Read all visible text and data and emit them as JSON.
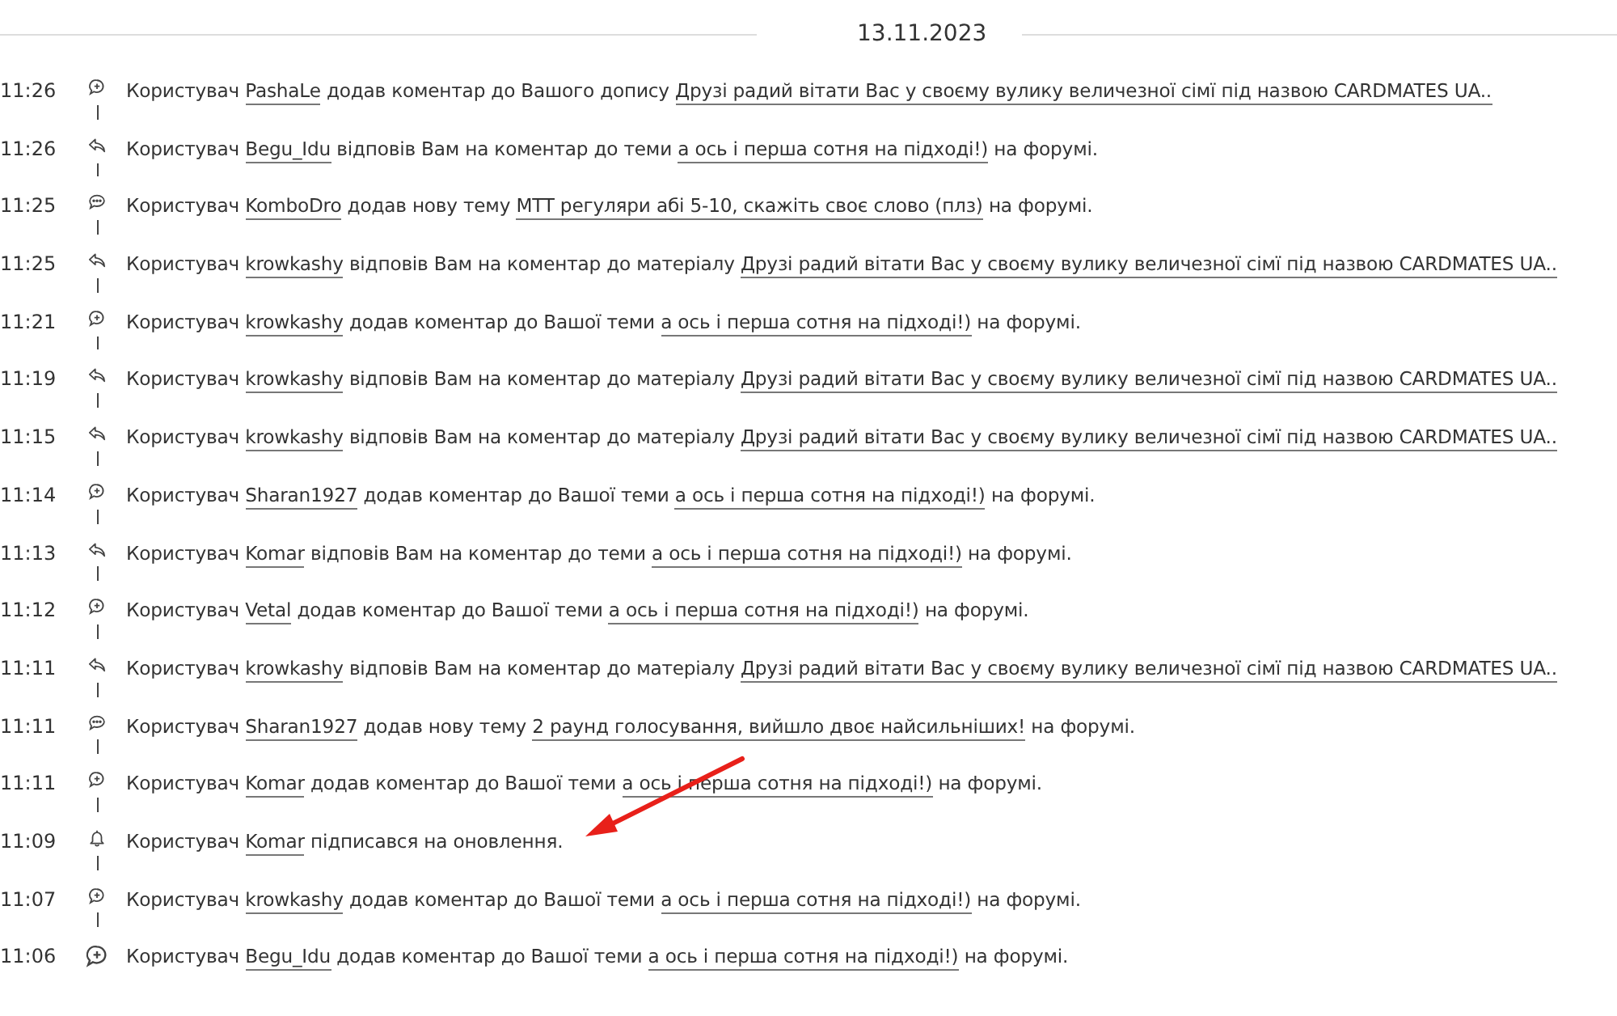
{
  "date": "13.11.2023",
  "notifications": [
    {
      "time": "11:26",
      "kind": "comment",
      "message": [
        {
          "kind": "text",
          "text": "Користувач"
        },
        {
          "kind": "user",
          "text": "PashaLe"
        },
        {
          "kind": "text",
          "text": "додав коментар до Вашого допису"
        },
        {
          "kind": "topic",
          "text": "Друзі радий вітати Вас у своєму вулику величезної сімї під назвою CARDMATES UA.."
        }
      ]
    },
    {
      "time": "11:26",
      "kind": "reply",
      "message": [
        {
          "kind": "text",
          "text": "Користувач"
        },
        {
          "kind": "user",
          "text": "Begu_Idu"
        },
        {
          "kind": "text",
          "text": "відповів Вам на коментар до теми"
        },
        {
          "kind": "topic",
          "text": "а ось і перша сотня на підході!)"
        },
        {
          "kind": "text",
          "text": "на форумі."
        }
      ]
    },
    {
      "time": "11:25",
      "kind": "topic",
      "message": [
        {
          "kind": "text",
          "text": "Користувач"
        },
        {
          "kind": "user",
          "text": "KomboDro"
        },
        {
          "kind": "text",
          "text": "додав нову тему"
        },
        {
          "kind": "topic",
          "text": "MTT регуляри абі 5-10, скажіть своє слово (плз)"
        },
        {
          "kind": "text",
          "text": "на форумі."
        }
      ]
    },
    {
      "time": "11:25",
      "kind": "reply",
      "message": [
        {
          "kind": "text",
          "text": "Користувач"
        },
        {
          "kind": "user",
          "text": "krowkashy"
        },
        {
          "kind": "text",
          "text": "відповів Вам на коментар до матеріалу"
        },
        {
          "kind": "topic",
          "text": "Друзі радий вітати Вас у своєму вулику величезної сімї під назвою CARDMATES UA.."
        }
      ]
    },
    {
      "time": "11:21",
      "kind": "comment",
      "message": [
        {
          "kind": "text",
          "text": "Користувач"
        },
        {
          "kind": "user",
          "text": "krowkashy"
        },
        {
          "kind": "text",
          "text": "додав коментар до Вашої теми"
        },
        {
          "kind": "topic",
          "text": "а ось і перша сотня на підході!)"
        },
        {
          "kind": "text",
          "text": "на форумі."
        }
      ]
    },
    {
      "time": "11:19",
      "kind": "reply",
      "message": [
        {
          "kind": "text",
          "text": "Користувач"
        },
        {
          "kind": "user",
          "text": "krowkashy"
        },
        {
          "kind": "text",
          "text": "відповів Вам на коментар до матеріалу"
        },
        {
          "kind": "topic",
          "text": "Друзі радий вітати Вас у своєму вулику величезної сімї під назвою CARDMATES UA.."
        }
      ]
    },
    {
      "time": "11:15",
      "kind": "reply",
      "message": [
        {
          "kind": "text",
          "text": "Користувач"
        },
        {
          "kind": "user",
          "text": "krowkashy"
        },
        {
          "kind": "text",
          "text": "відповів Вам на коментар до матеріалу"
        },
        {
          "kind": "topic",
          "text": "Друзі радий вітати Вас у своєму вулику величезної сімї під назвою CARDMATES UA.."
        }
      ]
    },
    {
      "time": "11:14",
      "kind": "comment",
      "message": [
        {
          "kind": "text",
          "text": "Користувач"
        },
        {
          "kind": "user",
          "text": "Sharan1927"
        },
        {
          "kind": "text",
          "text": "додав коментар до Вашої теми"
        },
        {
          "kind": "topic",
          "text": "а ось і перша сотня на підході!)"
        },
        {
          "kind": "text",
          "text": "на форумі."
        }
      ]
    },
    {
      "time": "11:13",
      "kind": "reply",
      "message": [
        {
          "kind": "text",
          "text": "Користувач"
        },
        {
          "kind": "user",
          "text": "Komar"
        },
        {
          "kind": "text",
          "text": "відповів Вам на коментар до теми"
        },
        {
          "kind": "topic",
          "text": "а ось і перша сотня на підході!)"
        },
        {
          "kind": "text",
          "text": "на форумі."
        }
      ]
    },
    {
      "time": "11:12",
      "kind": "comment",
      "message": [
        {
          "kind": "text",
          "text": "Користувач"
        },
        {
          "kind": "user",
          "text": "Vetal"
        },
        {
          "kind": "text",
          "text": "додав коментар до Вашої теми"
        },
        {
          "kind": "topic",
          "text": "а ось і перша сотня на підході!)"
        },
        {
          "kind": "text",
          "text": "на форумі."
        }
      ]
    },
    {
      "time": "11:11",
      "kind": "reply",
      "message": [
        {
          "kind": "text",
          "text": "Користувач"
        },
        {
          "kind": "user",
          "text": "krowkashy"
        },
        {
          "kind": "text",
          "text": "відповів Вам на коментар до матеріалу"
        },
        {
          "kind": "topic",
          "text": "Друзі радий вітати Вас у своєму вулику величезної сімї під назвою CARDMATES UA.."
        }
      ]
    },
    {
      "time": "11:11",
      "kind": "topic",
      "message": [
        {
          "kind": "text",
          "text": "Користувач"
        },
        {
          "kind": "user",
          "text": "Sharan1927"
        },
        {
          "kind": "text",
          "text": "додав нову тему"
        },
        {
          "kind": "topic",
          "text": "2 раунд голосування, вийшло двоє найсильніших!"
        },
        {
          "kind": "text",
          "text": "на форумі."
        }
      ]
    },
    {
      "time": "11:11",
      "kind": "comment",
      "message": [
        {
          "kind": "text",
          "text": "Користувач"
        },
        {
          "kind": "user",
          "text": "Komar"
        },
        {
          "kind": "text",
          "text": "додав коментар до Вашої теми"
        },
        {
          "kind": "topic",
          "text": "а ось і перша сотня на підході!)"
        },
        {
          "kind": "text",
          "text": "на форумі."
        }
      ]
    },
    {
      "time": "11:09",
      "kind": "bell",
      "message": [
        {
          "kind": "text",
          "text": "Користувач"
        },
        {
          "kind": "user",
          "text": "Komar"
        },
        {
          "kind": "text",
          "text": "підписався на оновлення."
        }
      ]
    },
    {
      "time": "11:07",
      "kind": "comment",
      "message": [
        {
          "kind": "text",
          "text": "Користувач"
        },
        {
          "kind": "user",
          "text": "krowkashy"
        },
        {
          "kind": "text",
          "text": "додав коментар до Вашої теми"
        },
        {
          "kind": "topic",
          "text": "а ось і перша сотня на підході!)"
        },
        {
          "kind": "text",
          "text": "на форумі."
        }
      ]
    },
    {
      "time": "11:06",
      "kind": "comment",
      "message": [
        {
          "kind": "text",
          "text": "Користувач"
        },
        {
          "kind": "user",
          "text": "Begu_Idu"
        },
        {
          "kind": "text",
          "text": "додав коментар до Вашої теми"
        },
        {
          "kind": "topic",
          "text": "а ось і перша сотня на підході!)"
        },
        {
          "kind": "text",
          "text": "на форумі."
        }
      ]
    }
  ]
}
